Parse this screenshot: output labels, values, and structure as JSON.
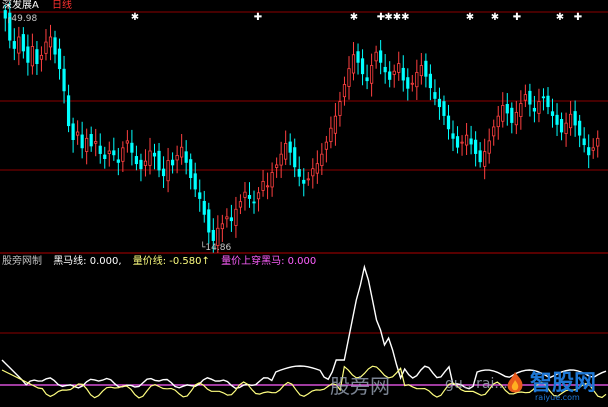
{
  "main_panel": {
    "title": "深发展A",
    "period": "日线",
    "high_label": "49.98",
    "low_label": "14.86"
  },
  "indicator_panel": {
    "source": "股旁网制",
    "items": [
      {
        "text": "黑马线: 0.000,",
        "color": "#ffffff"
      },
      {
        "text": "量价线: -0.580↑",
        "color": "#ffff80"
      },
      {
        "text": "量价上穿黑马: 0.000",
        "color": "#ff60ff"
      }
    ]
  },
  "watermark": {
    "main": "股旁网",
    "url": "gu.. rai...",
    "logo": "智股网",
    "logo_sub": "raiyue.com"
  },
  "colors": {
    "up": "#ff4040",
    "down": "#00ffff",
    "grid": "#8b0000",
    "black_horse": "#ffffff",
    "volume_price": "#ffff80",
    "cross": "#ff60ff"
  },
  "chart_data": {
    "type": "candlestick",
    "signal_marks": [
      "✱",
      "✚",
      "✱",
      "✚",
      "✱✱✱",
      "✱",
      "✱",
      "✚",
      "✱",
      "✚"
    ],
    "closes": [
      49.98,
      46.5,
      45.2,
      47.0,
      44.8,
      43.0,
      45.5,
      42.8,
      44.1,
      46.2,
      47.0,
      44.3,
      42.0,
      38.5,
      33.0,
      30.8,
      32.0,
      29.5,
      31.0,
      29.8,
      30.5,
      28.6,
      27.8,
      29.0,
      28.4,
      27.2,
      29.5,
      30.6,
      28.8,
      27.0,
      26.2,
      27.4,
      29.0,
      28.2,
      26.0,
      25.1,
      27.5,
      26.8,
      28.3,
      29.6,
      27.2,
      24.8,
      23.0,
      21.5,
      19.0,
      16.2,
      14.86,
      16.8,
      17.5,
      18.6,
      18.0,
      19.8,
      21.0,
      22.5,
      21.5,
      20.8,
      22.4,
      24.2,
      23.5,
      25.6,
      26.8,
      28.5,
      30.2,
      28.8,
      26.5,
      25.0,
      23.9,
      24.6,
      26.2,
      27.0,
      28.5,
      30.4,
      32.6,
      34.5,
      36.8,
      39.5,
      42.0,
      44.2,
      43.0,
      41.2,
      40.1,
      42.5,
      44.6,
      43.0,
      41.5,
      40.3,
      41.6,
      42.8,
      40.2,
      38.9,
      39.7,
      41.4,
      42.5,
      40.8,
      39.0,
      37.3,
      36.0,
      34.6,
      32.5,
      31.0,
      29.6,
      30.4,
      31.5,
      30.1,
      28.6,
      27.3,
      28.9,
      30.6,
      32.8,
      34.5,
      36.2,
      35.0,
      33.5,
      35.1,
      36.5,
      37.9,
      36.4,
      35.3,
      36.8,
      37.5,
      36.0,
      34.6,
      33.2,
      32.0,
      33.4,
      34.8,
      33.1,
      31.5,
      30.0,
      28.4,
      29.5,
      31.0
    ]
  }
}
